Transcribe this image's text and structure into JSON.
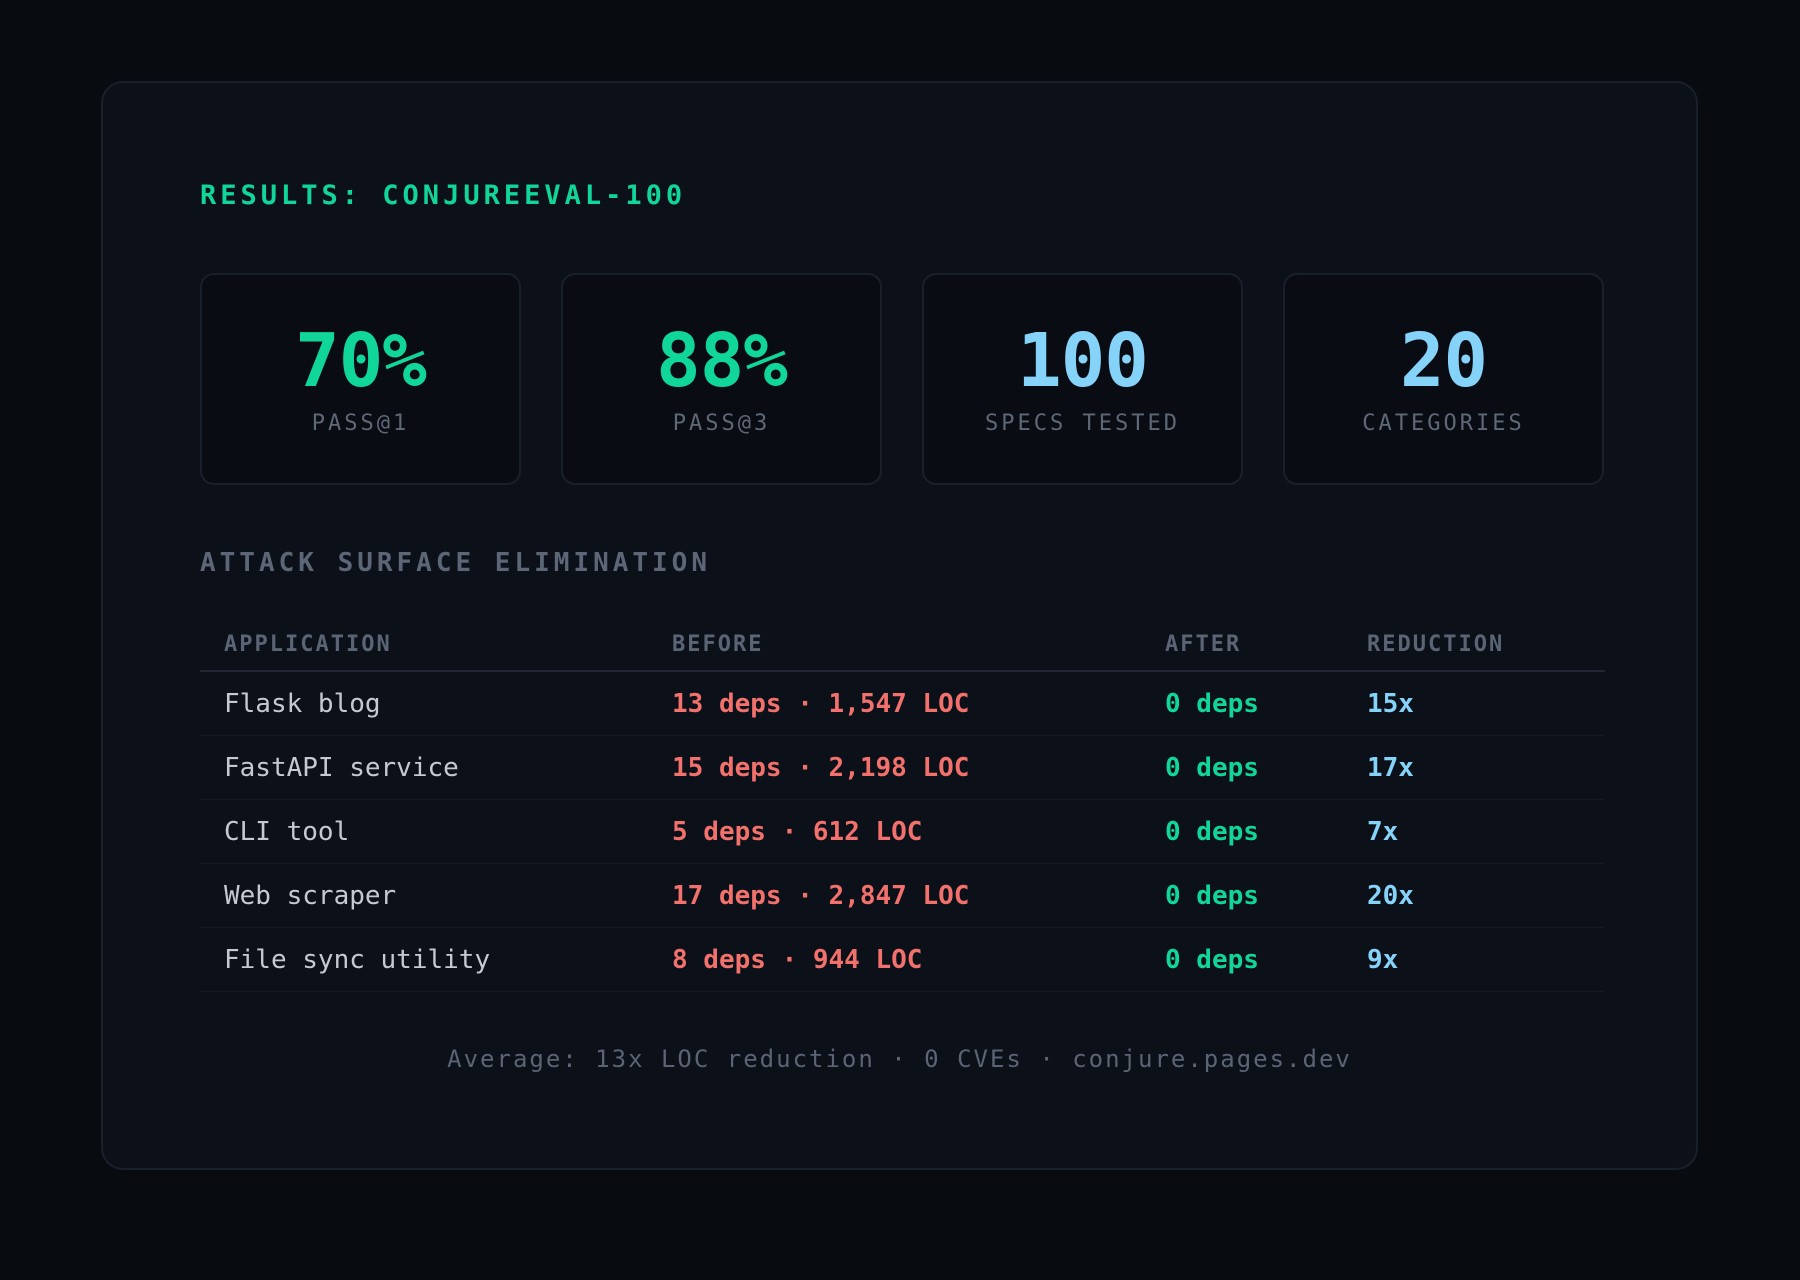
{
  "title": "RESULTS: CONJUREEVAL-100",
  "stats": [
    {
      "value": "70%",
      "label": "PASS@1",
      "color": "#10d69a"
    },
    {
      "value": "88%",
      "label": "PASS@3",
      "color": "#10d69a"
    },
    {
      "value": "100",
      "label": "SPECS TESTED",
      "color": "#86d3fa"
    },
    {
      "value": "20",
      "label": "CATEGORIES",
      "color": "#86d3fa"
    }
  ],
  "section_title": "ATTACK SURFACE ELIMINATION",
  "table": {
    "headers": [
      "APPLICATION",
      "BEFORE",
      "AFTER",
      "REDUCTION"
    ],
    "rows": [
      {
        "application": "Flask blog",
        "before": "13 deps · 1,547 LOC",
        "after": "0 deps",
        "reduction": "15x"
      },
      {
        "application": "FastAPI service",
        "before": "15 deps · 2,198 LOC",
        "after": "0 deps",
        "reduction": "17x"
      },
      {
        "application": "CLI tool",
        "before": "5 deps · 612 LOC",
        "after": "0 deps",
        "reduction": "7x"
      },
      {
        "application": "Web scraper",
        "before": "17 deps · 2,847 LOC",
        "after": "0 deps",
        "reduction": "20x"
      },
      {
        "application": "File sync utility",
        "before": "8 deps · 944 LOC",
        "after": "0 deps",
        "reduction": "9x"
      }
    ]
  },
  "footer": "Average: 13x LOC reduction · 0 CVEs · conjure.pages.dev",
  "colors": {
    "accent_green": "#10d69a",
    "accent_blue": "#86d3fa",
    "accent_red": "#f2716c",
    "muted": "#5a6474",
    "background": "#080b10",
    "card": "#0c1018"
  }
}
